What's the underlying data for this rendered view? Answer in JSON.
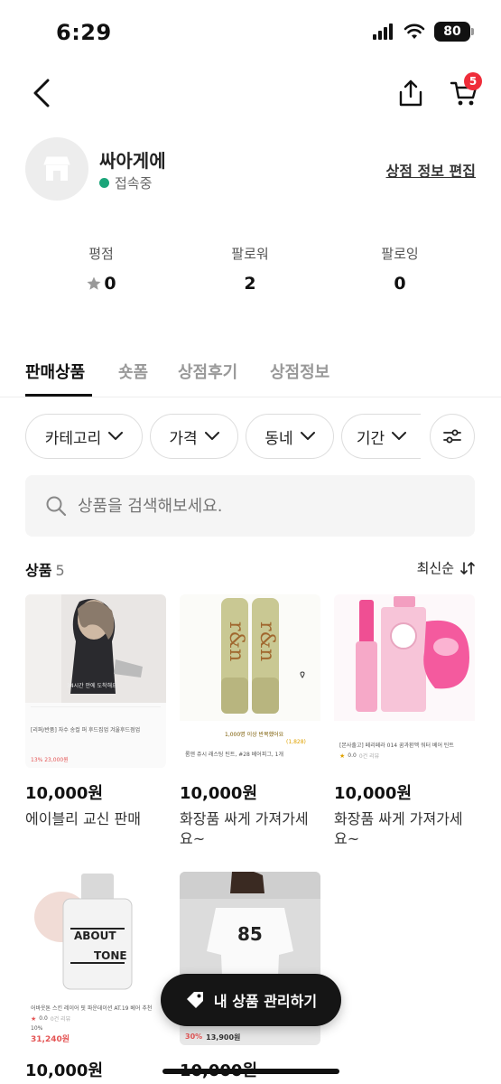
{
  "status": {
    "time": "6:29",
    "battery": "80"
  },
  "nav": {
    "cart_badge": "5"
  },
  "shop": {
    "name": "싸아게에",
    "status": "접속중",
    "edit_link": "상점 정보 편집"
  },
  "stats": [
    {
      "label": "평점",
      "value": "0"
    },
    {
      "label": "팔로워",
      "value": "2"
    },
    {
      "label": "팔로잉",
      "value": "0"
    }
  ],
  "tabs": [
    "판매상품",
    "숏폼",
    "상점후기",
    "상점정보"
  ],
  "filters": [
    "카테고리",
    "가격",
    "동네",
    "기간"
  ],
  "search": {
    "placeholder": "상품을 검색해보세요."
  },
  "products": {
    "label": "상품",
    "count": "5",
    "sort": "최신순",
    "items": [
      {
        "price": "10,000원",
        "title": "에이블리 교신 판매",
        "thumb_text": [
          "34시간 안에 도착해요",
          "[리퍼/반품] 자수 송컬 퍼 후드집업 겨울후드점업",
          "13% 23,000원"
        ]
      },
      {
        "price": "10,000원",
        "title": "화장품 싸게 가져가세요~",
        "thumb_text": [
          "1,000명 이상 반복했어요",
          "롬앤 쥬시 래스팅 틴트, #28 베어피그, 1개",
          "(1,828)"
        ]
      },
      {
        "price": "10,000원",
        "title": "화장품 싸게 가져가세요~",
        "thumb_text": [
          "[본사출고] 페리페라 014 꿈과환멕 워터 베어 틴트",
          "0.0",
          "0건 리뷰"
        ]
      },
      {
        "price": "10,000원",
        "title": "",
        "thumb_text": [
          "ABOUT",
          "TONE",
          "어바웃톤 스킨 레이어 핏 파운데이션 AT.19 베어 추천",
          "10%",
          "31,240원",
          "0.0",
          "0건 리뷰"
        ]
      },
      {
        "price": "10,000원",
        "title": "",
        "thumb_text": [
          "30%",
          "13,900원"
        ]
      }
    ]
  },
  "fab": {
    "label": "내 상품 관리하기"
  }
}
